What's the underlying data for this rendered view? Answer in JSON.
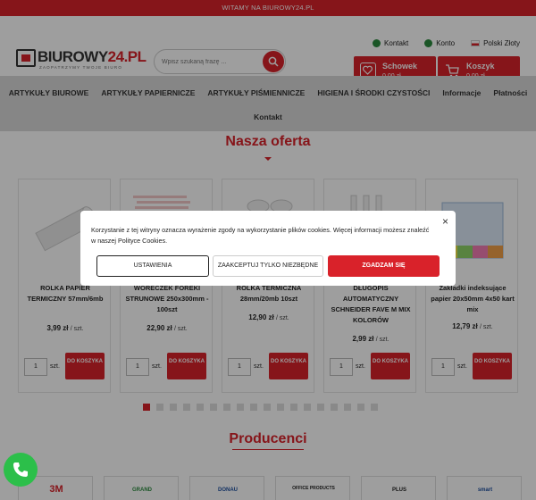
{
  "topbar": {
    "text": "WITAMY NA BIUROWY24.PL"
  },
  "header": {
    "logo_main": "BIUROWY",
    "logo_accent": "24.PL",
    "logo_tagline": "ZAOPATRZYMY TWOJE BIURO",
    "search_placeholder": "Wpisz szukaną frazę ...",
    "links": {
      "contact": "Kontakt",
      "account": "Konto",
      "currency": "Polski Złoty"
    },
    "wishlist": {
      "label": "Schowek",
      "value": "0,00 zł"
    },
    "cart": {
      "label": "Koszyk",
      "value": "0,00 zł"
    }
  },
  "nav": {
    "row1": [
      "ARTYKUŁY BIUROWE",
      "ARTYKUŁY PAPIERNICZE",
      "ARTYKUŁY PIŚMIENNICZE",
      "HIGIENA I ŚRODKI CZYSTOŚCI",
      "Informacje",
      "Płatności"
    ],
    "row2": [
      "Kontakt"
    ]
  },
  "offer": {
    "title": "Nasza oferta",
    "products": [
      {
        "name": "ROLKA PAPIER TERMICZNY 57mm/6mb",
        "price": "3,99 zł",
        "unit": "/ szt."
      },
      {
        "name": "WORECZEK FOREKI STRUNOWE 250x300mm - 100szt",
        "price": "22,90 zł",
        "unit": "/ szt."
      },
      {
        "name": "ROLKA TERMICZNA 28mm/20mb 10szt",
        "price": "12,90 zł",
        "unit": "/ szt."
      },
      {
        "name": "DŁUGOPIS AUTOMATYCZNY SCHNEIDER FAVE M MIX KOLORÓW",
        "price": "2,99 zł",
        "unit": "/ szt."
      },
      {
        "name": "Zakładki indeksujące papier 20x50mm 4x50 kart mix",
        "price": "12,79 zł",
        "unit": "/ szt."
      }
    ],
    "qty_value": "1",
    "qty_unit": "szt.",
    "add_button": "DO KOSZYKA"
  },
  "producers": {
    "title": "Producenci",
    "brands": [
      "3M",
      "GRAND",
      "DONAU",
      "OFFICE PRODUCTS",
      "PLUS",
      "smart"
    ]
  },
  "cookie": {
    "message": "Korzystanie z tej witryny oznacza wyrażenie zgody na wykorzystanie plików cookies. Więcej informacji możesz znaleźć w naszej Polityce Cookies.",
    "close": "×",
    "btn_settings": "USTAWIENIA",
    "btn_necessary": "ZAAKCEPTUJ TYLKO NIEZBĘDNE",
    "btn_accept": "ZGADZAM SIĘ"
  },
  "colors": {
    "brand_red": "#d9222a",
    "nav_gray": "#d9d9d9",
    "phone_green": "#2cbf4a"
  }
}
